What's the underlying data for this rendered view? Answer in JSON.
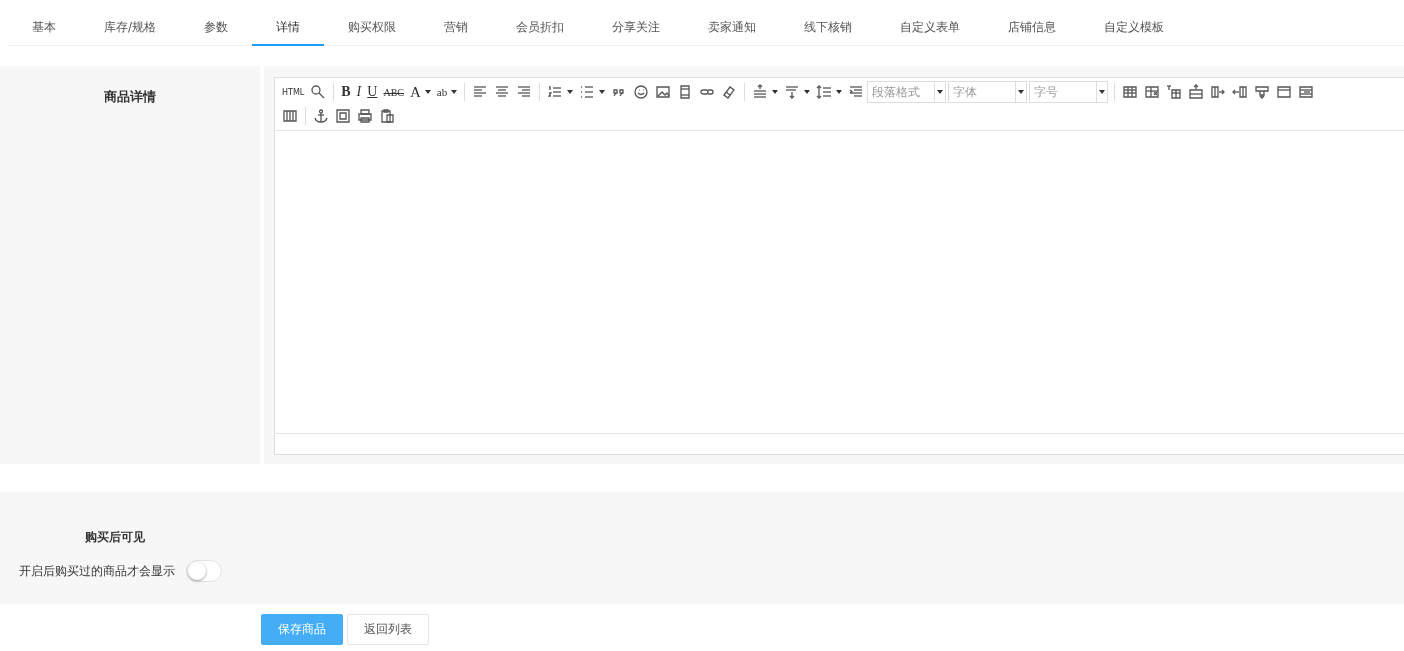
{
  "tabs": [
    {
      "label": "基本",
      "selected": false
    },
    {
      "label": "库存/规格",
      "selected": false
    },
    {
      "label": "参数",
      "selected": false
    },
    {
      "label": "详情",
      "selected": true
    },
    {
      "label": "购买权限",
      "selected": false
    },
    {
      "label": "营销",
      "selected": false
    },
    {
      "label": "会员折扣",
      "selected": false
    },
    {
      "label": "分享关注",
      "selected": false
    },
    {
      "label": "卖家通知",
      "selected": false
    },
    {
      "label": "线下核销",
      "selected": false
    },
    {
      "label": "自定义表单",
      "selected": false
    },
    {
      "label": "店铺信息",
      "selected": false
    },
    {
      "label": "自定义模板",
      "selected": false
    }
  ],
  "detail": {
    "label": "商品详情",
    "editor": {
      "glyphs": [
        "HTML",
        "B",
        "I",
        "U",
        "ABC",
        "A",
        "ab"
      ],
      "selects": [
        {
          "placeholder": "段落格式"
        },
        {
          "placeholder": "字体"
        },
        {
          "placeholder": "字号"
        }
      ]
    }
  },
  "visibility": {
    "title": "购买后可见",
    "description": "开启后购买过的商品才会显示",
    "on": false
  },
  "buttons": [
    {
      "label": "保存商品",
      "kind": "primary"
    },
    {
      "label": "返回列表",
      "kind": "default"
    }
  ]
}
